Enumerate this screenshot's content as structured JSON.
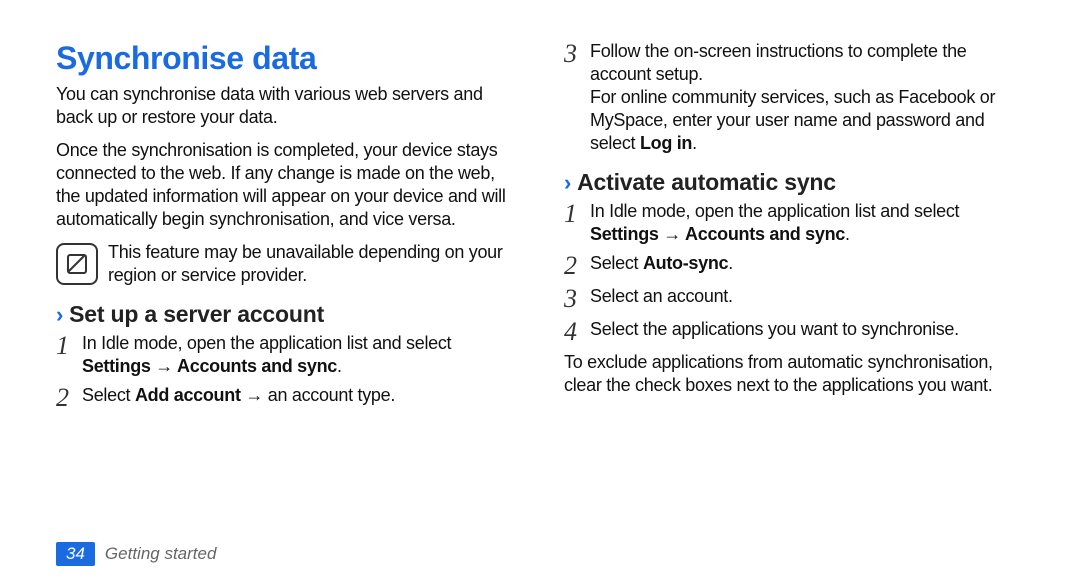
{
  "page": {
    "number": "34",
    "section": "Getting started",
    "title": "Synchronise data",
    "intro1": "You can synchronise data with various web servers and back up or restore your data.",
    "intro2": "Once the synchronisation is completed, your device stays connected to the web. If any change is made on the web, the updated information will appear on your device and will automatically begin synchronisation, and vice versa.",
    "note": "This feature may be unavailable depending on your region or service provider.",
    "sub1": {
      "title": "Set up a server account",
      "step1a": "In Idle mode, open the application list and select ",
      "step1b": "Settings → Accounts and sync",
      "step1c": ".",
      "step2a": "Select ",
      "step2b": "Add account",
      "step2c": " → an account type.",
      "step3a": "Follow the on-screen instructions to complete the account setup.",
      "step3b": "For online community services, such as Facebook or MySpace, enter your user name and password and select ",
      "step3c": "Log in",
      "step3d": "."
    },
    "sub2": {
      "title": "Activate automatic sync",
      "step1a": "In Idle mode, open the application list and select ",
      "step1b": "Settings → Accounts and sync",
      "step1c": ".",
      "step2a": "Select ",
      "step2b": "Auto-sync",
      "step2c": ".",
      "step3": "Select an account.",
      "step4": "Select the applications you want to synchronise.",
      "outro": "To exclude applications from automatic synchronisation, clear the check boxes next to the applications you want."
    }
  }
}
